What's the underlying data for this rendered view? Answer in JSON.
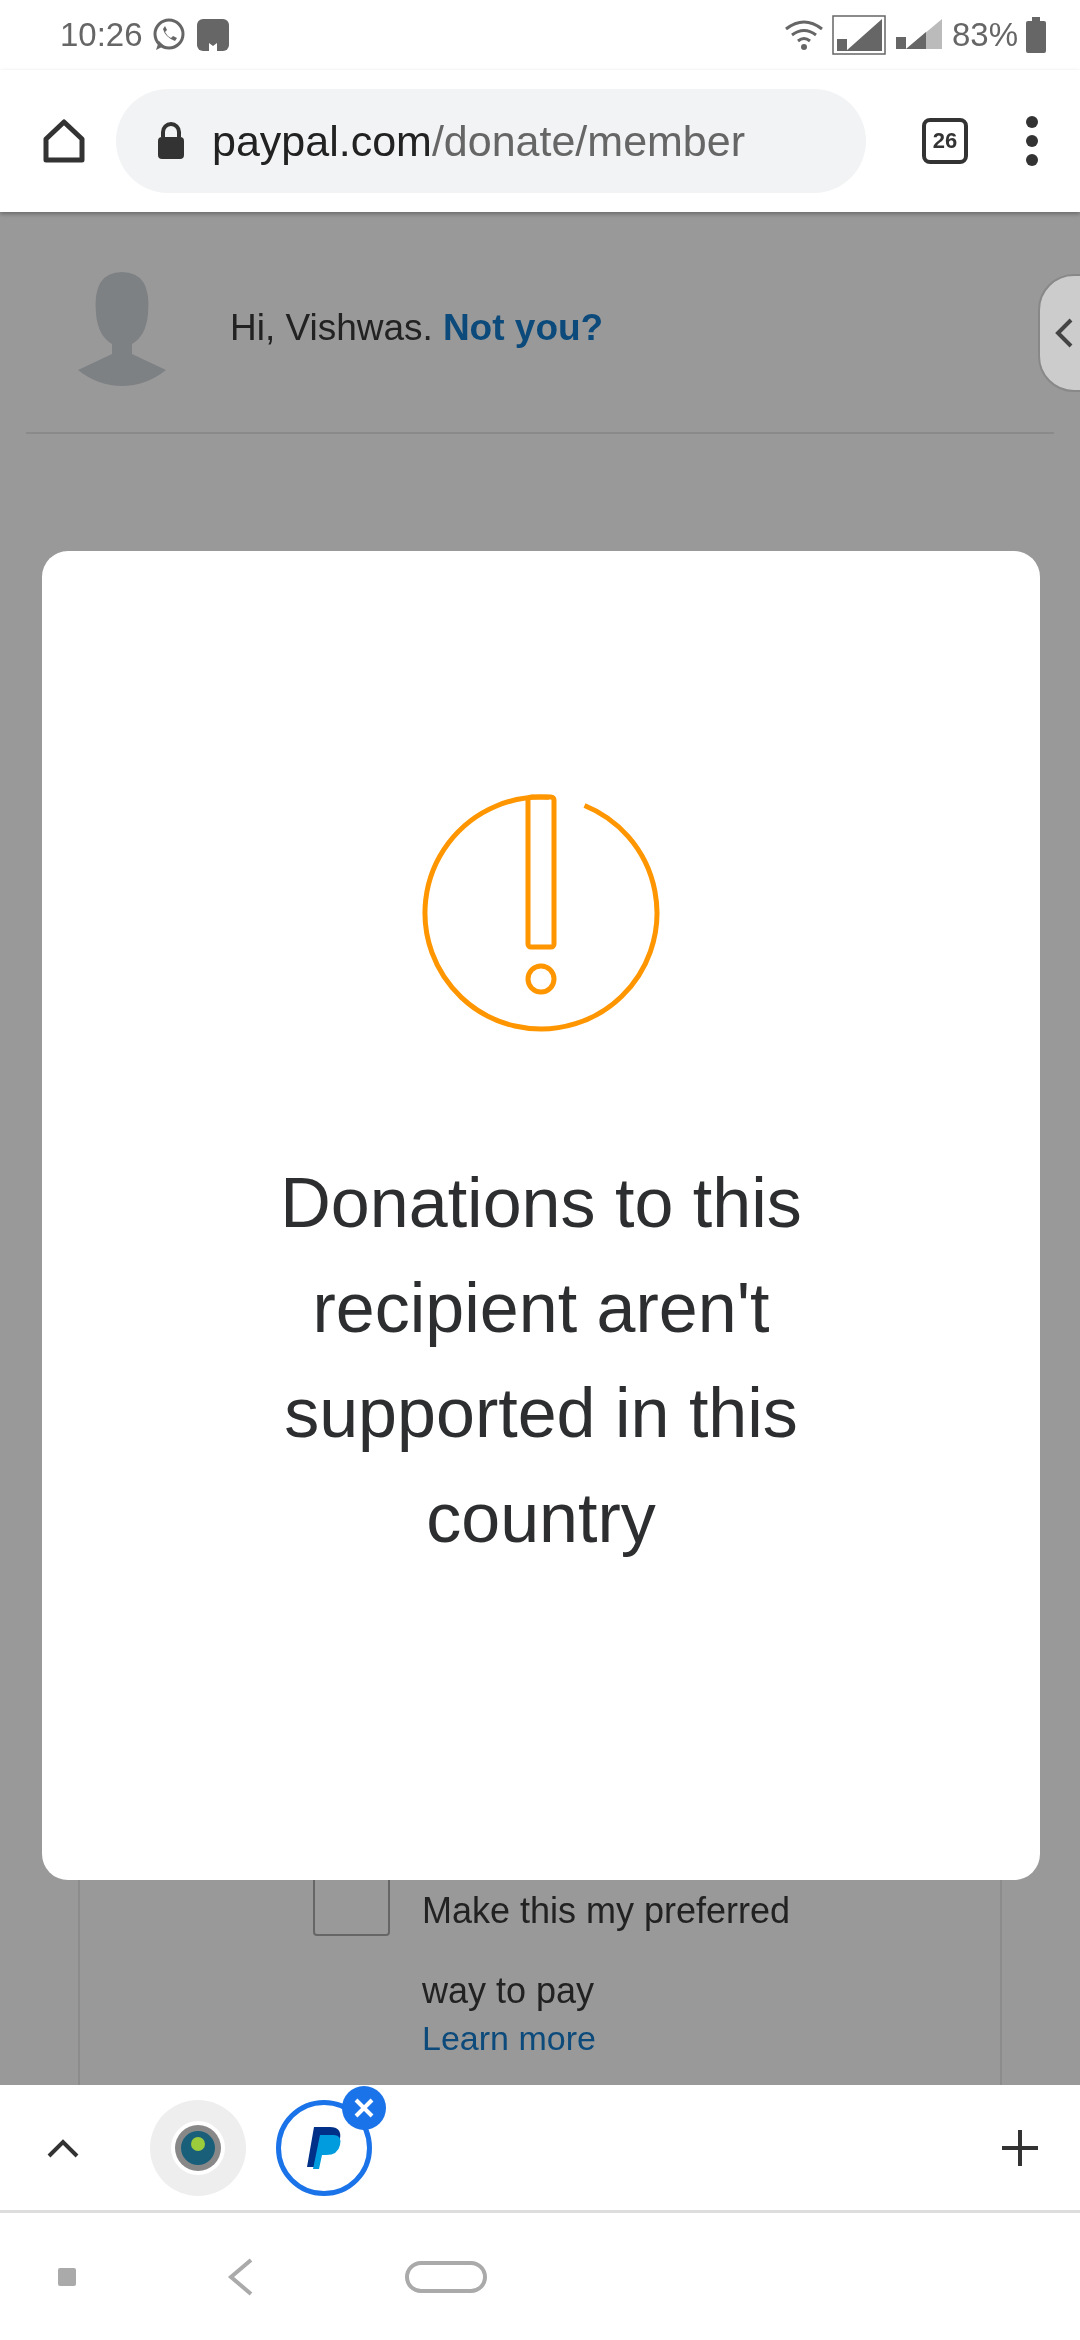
{
  "status_bar": {
    "time": "10:26",
    "battery": "83%"
  },
  "browser": {
    "url_host": "paypal.com",
    "url_path": "/donate/member",
    "tab_count": "26"
  },
  "page": {
    "greeting": "Hi, Vishwas.",
    "not_you_link": "Not you?",
    "preferred": {
      "checked": false,
      "label": "Make this my preferred way to pay",
      "link": "Learn more"
    }
  },
  "modal": {
    "message": "Donations to this recipient aren't supported in this country"
  },
  "tab_group": {
    "tabs": [
      {
        "kind": "forum",
        "selected": false
      },
      {
        "kind": "paypal",
        "selected": true
      }
    ]
  }
}
